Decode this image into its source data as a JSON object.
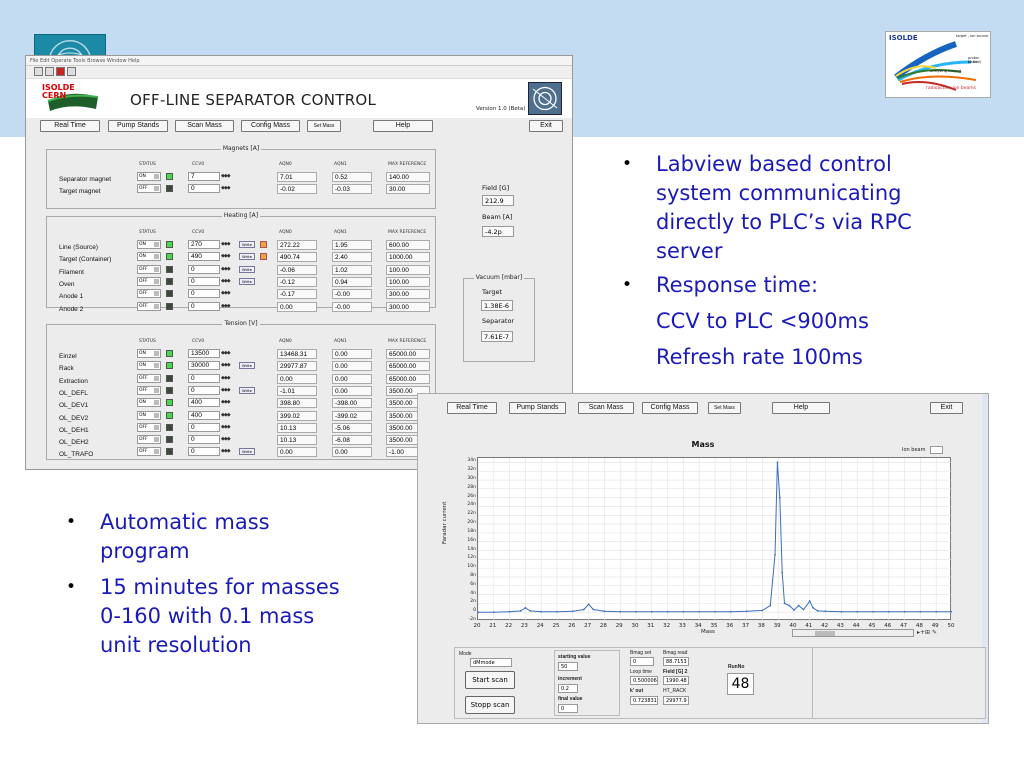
{
  "bullets_right": [
    "Labview based control system communicating directly to PLC’s via RPC server",
    "Response time:"
  ],
  "bullets_right_lines": {
    "b1l1": "Labview based control",
    "b1l2": "system communicating",
    "b1l3": "directly to PLC’s via RPC",
    "b1l4": "server",
    "b2l1": "Response time:",
    "p1": "CCV to PLC <900ms",
    "p2": "Refresh rate 100ms"
  },
  "bullets_left_lines": {
    "b1l1": "Automatic mass",
    "b1l2": "program",
    "b2l1": "15 minutes for masses",
    "b2l2": "0-160 with 0.1 mass",
    "b2l3": "unit resolution"
  },
  "isolde_logo": {
    "title": "ISOLDE",
    "l1": "target - ion source",
    "l2": "proton beam",
    "l3": "(1 GeV)",
    "l4": "analysing magnet",
    "l5": "radioactive ion beams"
  },
  "app": {
    "logo_line1": "ISOLDE",
    "logo_line2": "CERN",
    "title": "OFF-LINE SEPARATOR CONTROL",
    "version": "Version 1.0 (Beta)",
    "nav": {
      "real_time": "Real Time",
      "pump_stands": "Pump Stands",
      "scan_mass": "Scan Mass",
      "config_mass": "Config Mass",
      "set_mass": "Set Mass",
      "help": "Help",
      "exit": "Exit"
    },
    "cols": {
      "status": "STATUS",
      "ccv": "CCV0",
      "aqn0": "AQN0",
      "aqn1": "AQN1",
      "max": "MAX REFERENCE"
    },
    "write": "Write",
    "magnets": {
      "title": "Magnets [A]",
      "rows": [
        {
          "label": "Separator magnet",
          "status": "ON",
          "ccv": "7",
          "aqn0": "7.01",
          "aqn1": "0.52",
          "max": "140.00"
        },
        {
          "label": "Target magnet",
          "status": "OFF",
          "ccv": "0",
          "aqn0": "-0.02",
          "aqn1": "-0.03",
          "max": "30.00"
        }
      ]
    },
    "heating": {
      "title": "Heating [A]",
      "rows": [
        {
          "label": "Line (Source)",
          "status": "ON",
          "ccv": "270",
          "aqn0": "272.22",
          "aqn1": "1.95",
          "max": "600.00"
        },
        {
          "label": "Target (Container)",
          "status": "ON",
          "ccv": "490",
          "aqn0": "490.74",
          "aqn1": "2.40",
          "max": "1000.00"
        },
        {
          "label": "Filament",
          "status": "OFF",
          "ccv": "0",
          "aqn0": "-0.06",
          "aqn1": "1.02",
          "max": "100.00"
        },
        {
          "label": "Oven",
          "status": "OFF",
          "ccv": "0",
          "aqn0": "-0.12",
          "aqn1": "0.94",
          "max": "100.00"
        },
        {
          "label": "Anode 1",
          "status": "OFF",
          "ccv": "0",
          "aqn0": "-0.17",
          "aqn1": "-0.00",
          "max": "300.00"
        },
        {
          "label": "Anode 2",
          "status": "OFF",
          "ccv": "0",
          "aqn0": "0.00",
          "aqn1": "-0.00",
          "max": "300.00"
        }
      ]
    },
    "tension": {
      "title": "Tension [V]",
      "rows": [
        {
          "label": "Einzel",
          "status": "ON",
          "ccv": "13500",
          "aqn0": "13468.31",
          "aqn1": "0.00",
          "max": "65000.00"
        },
        {
          "label": "Rack",
          "status": "ON",
          "ccv": "30000",
          "aqn0": "29977.87",
          "aqn1": "0.00",
          "max": "65000.00"
        },
        {
          "label": "Extraction",
          "status": "OFF",
          "ccv": "0",
          "aqn0": "0.00",
          "aqn1": "0.00",
          "max": "65000.00"
        },
        {
          "label": "OL_DEFL",
          "status": "OFF",
          "ccv": "0",
          "aqn0": "-1.01",
          "aqn1": "0.00",
          "max": "3500.00"
        },
        {
          "label": "OL_DEV1",
          "status": "ON",
          "ccv": "400",
          "aqn0": "398.80",
          "aqn1": "-398.00",
          "max": "3500.00"
        },
        {
          "label": "OL_DEV2",
          "status": "ON",
          "ccv": "400",
          "aqn0": "399.02",
          "aqn1": "-399.02",
          "max": "3500.00"
        },
        {
          "label": "OL_DEH1",
          "status": "OFF",
          "ccv": "0",
          "aqn0": "10.13",
          "aqn1": "-5.06",
          "max": "3500.00"
        },
        {
          "label": "OL_DEH2",
          "status": "OFF",
          "ccv": "0",
          "aqn0": "10.13",
          "aqn1": "-6.08",
          "max": "3500.00"
        },
        {
          "label": "OL_TRAFO",
          "status": "OFF",
          "ccv": "0",
          "aqn0": "0.00",
          "aqn1": "0.00",
          "max": "-1.00"
        }
      ]
    },
    "field_label": "Field [G]",
    "field_value": "212.9",
    "beam_label": "Beam [A]",
    "beam_value": "-4.2p",
    "vacuum_title": "Vacuum [mbar]",
    "target_label": "Target",
    "target_value": "1.38E-6",
    "separator_label": "Separator",
    "separator_value": "7.61E-7"
  },
  "scan": {
    "chart_title": "Mass",
    "legend": "Ion beam",
    "mode_label": "Mode",
    "mode_value": "dMmode",
    "start_scan": "Start scan",
    "stop_scan": "Stopp scan",
    "starting_value_label": "starting value",
    "starting_value": "50",
    "increment_label": "increment",
    "increment": "0.2",
    "final_value_label": "final value",
    "final_value": "0",
    "bmag_set_label": "Bmag set",
    "bmag_set": "0",
    "bmag_read_label": "Bmag read",
    "bmag_read": "88.7153",
    "loop_time_label": "Loop time",
    "loop_time": "0.500006",
    "field_g2_label": "Field [G] 2",
    "field_g2": "1990.48",
    "k_out_label": "k' out",
    "k_out": "0.723831",
    "ht_rack_label": "HT_RACK",
    "ht_rack": "29977.9",
    "runno_label": "RunNo",
    "runno": "48"
  },
  "chart_data": {
    "type": "line",
    "title": "Mass",
    "xlabel": "Mass",
    "ylabel": "Faradar current",
    "xlim": [
      20,
      50
    ],
    "ylim": [
      -2,
      35
    ],
    "x_ticks": [
      20,
      21,
      22,
      23,
      24,
      25,
      26,
      27,
      28,
      29,
      30,
      31,
      32,
      33,
      34,
      35,
      36,
      37,
      38,
      39,
      40,
      41,
      42,
      43,
      44,
      45,
      46,
      47,
      48,
      49,
      50
    ],
    "y_ticks": [
      "-2n",
      "0",
      "2n",
      "4n",
      "6n",
      "8n",
      "10n",
      "12n",
      "14n",
      "16n",
      "18n",
      "20n",
      "22n",
      "24n",
      "26n",
      "28n",
      "30n",
      "32n",
      "34n"
    ],
    "series": [
      {
        "name": "Ion beam",
        "x": [
          20,
          21,
          22,
          22.7,
          23,
          23.3,
          24,
          25,
          26,
          26.7,
          27,
          27.3,
          28,
          29,
          30,
          31,
          32,
          33,
          34,
          35,
          36,
          37,
          38,
          38.5,
          38.8,
          38.95,
          39.1,
          39.25,
          39.4,
          39.7,
          40,
          40.3,
          40.6,
          41,
          41.2,
          41.5,
          42,
          43,
          44,
          45,
          46,
          47,
          48,
          49,
          50
        ],
        "y": [
          0,
          0,
          0.1,
          0.3,
          1.0,
          0.3,
          0.1,
          0.1,
          0.2,
          0.6,
          1.8,
          0.6,
          0.2,
          0.1,
          0.1,
          0.1,
          0.1,
          0.1,
          0.1,
          0.1,
          0.1,
          0.2,
          0.4,
          1.5,
          13,
          34,
          26,
          9,
          2,
          1.5,
          0.5,
          1.5,
          0.6,
          2.5,
          1.0,
          0.3,
          0.2,
          0.1,
          0.1,
          0.1,
          0.1,
          0.1,
          0.1,
          0.1,
          0.1
        ]
      }
    ],
    "grid": true,
    "legend_position": "top-right"
  }
}
